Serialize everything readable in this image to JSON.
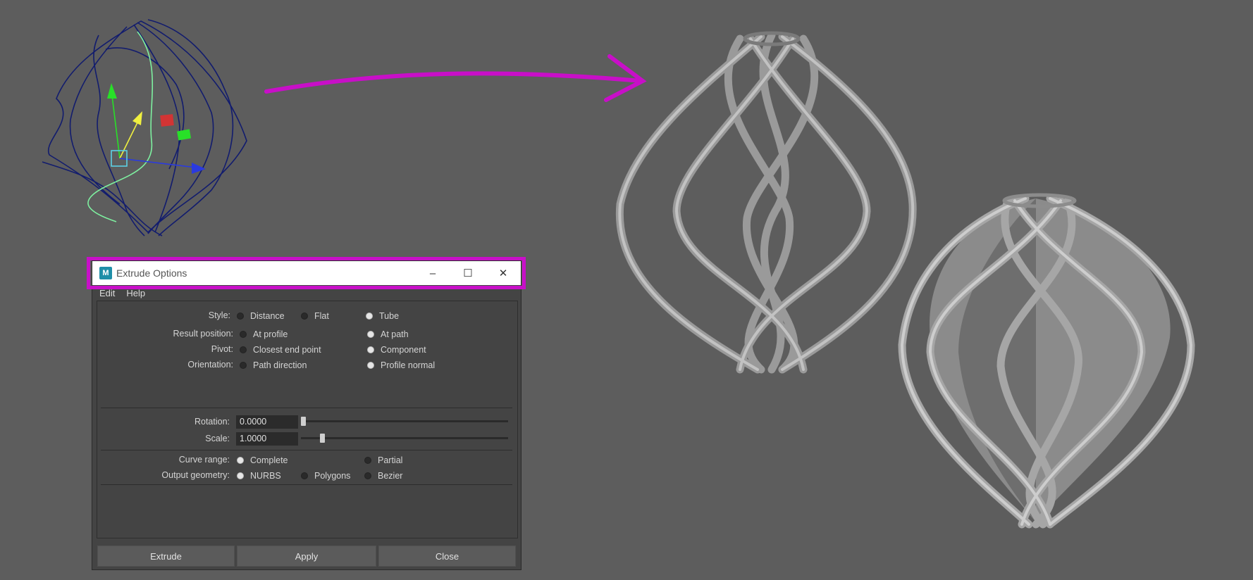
{
  "window": {
    "title": "Extrude Options",
    "icon": "maya-app-icon",
    "minimize_label": "–",
    "maximize_label": "☐",
    "close_label": "✕"
  },
  "menu": {
    "items": [
      "Edit",
      "Help"
    ]
  },
  "options": {
    "style": {
      "label": "Style:",
      "choices": [
        "Distance",
        "Flat",
        "Tube"
      ],
      "selected": "Tube"
    },
    "result_position": {
      "label": "Result position:",
      "choices": [
        "At profile",
        "At path"
      ],
      "selected": "At path"
    },
    "pivot": {
      "label": "Pivot:",
      "choices": [
        "Closest end point",
        "Component"
      ],
      "selected": "Component"
    },
    "orientation": {
      "label": "Orientation:",
      "choices": [
        "Path direction",
        "Profile normal"
      ],
      "selected": "Profile normal"
    },
    "rotation": {
      "label": "Rotation:",
      "value": "0.0000",
      "slider": 0.0
    },
    "scale": {
      "label": "Scale:",
      "value": "1.0000",
      "slider": 0.1
    },
    "curve_range": {
      "label": "Curve range:",
      "choices": [
        "Complete",
        "Partial"
      ],
      "selected": "Complete"
    },
    "output_geometry": {
      "label": "Output geometry:",
      "choices": [
        "NURBS",
        "Polygons",
        "Bezier"
      ],
      "selected": "NURBS"
    }
  },
  "buttons": {
    "extrude": "Extrude",
    "apply": "Apply",
    "close": "Close"
  },
  "colors": {
    "viewport_bg": "#5d5d5d",
    "highlight": "#c80fc8",
    "arrow": "#c80fc8",
    "wire_curve": "#121c6e",
    "path_curve": "#7ef0a0"
  }
}
